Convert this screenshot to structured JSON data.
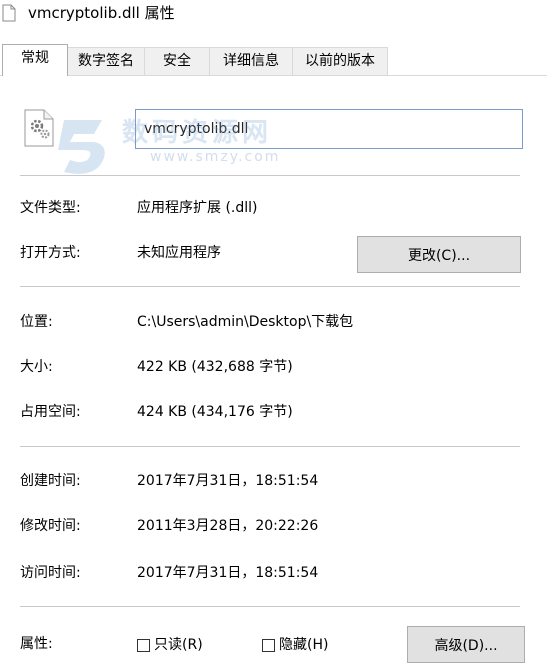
{
  "window": {
    "title": "vmcryptolib.dll 属性"
  },
  "tabs": [
    {
      "label": "常规",
      "active": true
    },
    {
      "label": "数字签名",
      "active": false
    },
    {
      "label": "安全",
      "active": false
    },
    {
      "label": "详细信息",
      "active": false
    },
    {
      "label": "以前的版本",
      "active": false
    }
  ],
  "general": {
    "file_name": "vmcryptolib.dll",
    "watermark": "数码资源网",
    "watermark_url": "www.smzy.com",
    "file_type_label": "文件类型:",
    "file_type_value": "应用程序扩展 (.dll)",
    "open_with_label": "打开方式:",
    "open_with_value": "未知应用程序",
    "change_button": "更改(C)...",
    "location_label": "位置:",
    "location_value": "C:\\Users\\admin\\Desktop\\下载包",
    "size_label": "大小:",
    "size_value": "422 KB (432,688 字节)",
    "size_on_disk_label": "占用空间:",
    "size_on_disk_value": "424 KB (434,176 字节)",
    "created_label": "创建时间:",
    "created_value": "2017年7月31日，18:51:54",
    "modified_label": "修改时间:",
    "modified_value": "2011年3月28日，20:22:26",
    "accessed_label": "访问时间:",
    "accessed_value": "2017年7月31日，18:51:54",
    "attributes_label": "属性:",
    "readonly_label": "只读(R)",
    "readonly_checked": false,
    "hidden_label": "隐藏(H)",
    "hidden_checked": false,
    "advanced_button": "高级(D)..."
  },
  "colors": {
    "input_border": "#7a9cc6",
    "button_bg": "#e1e1e1",
    "separator": "#c8c8c8"
  }
}
